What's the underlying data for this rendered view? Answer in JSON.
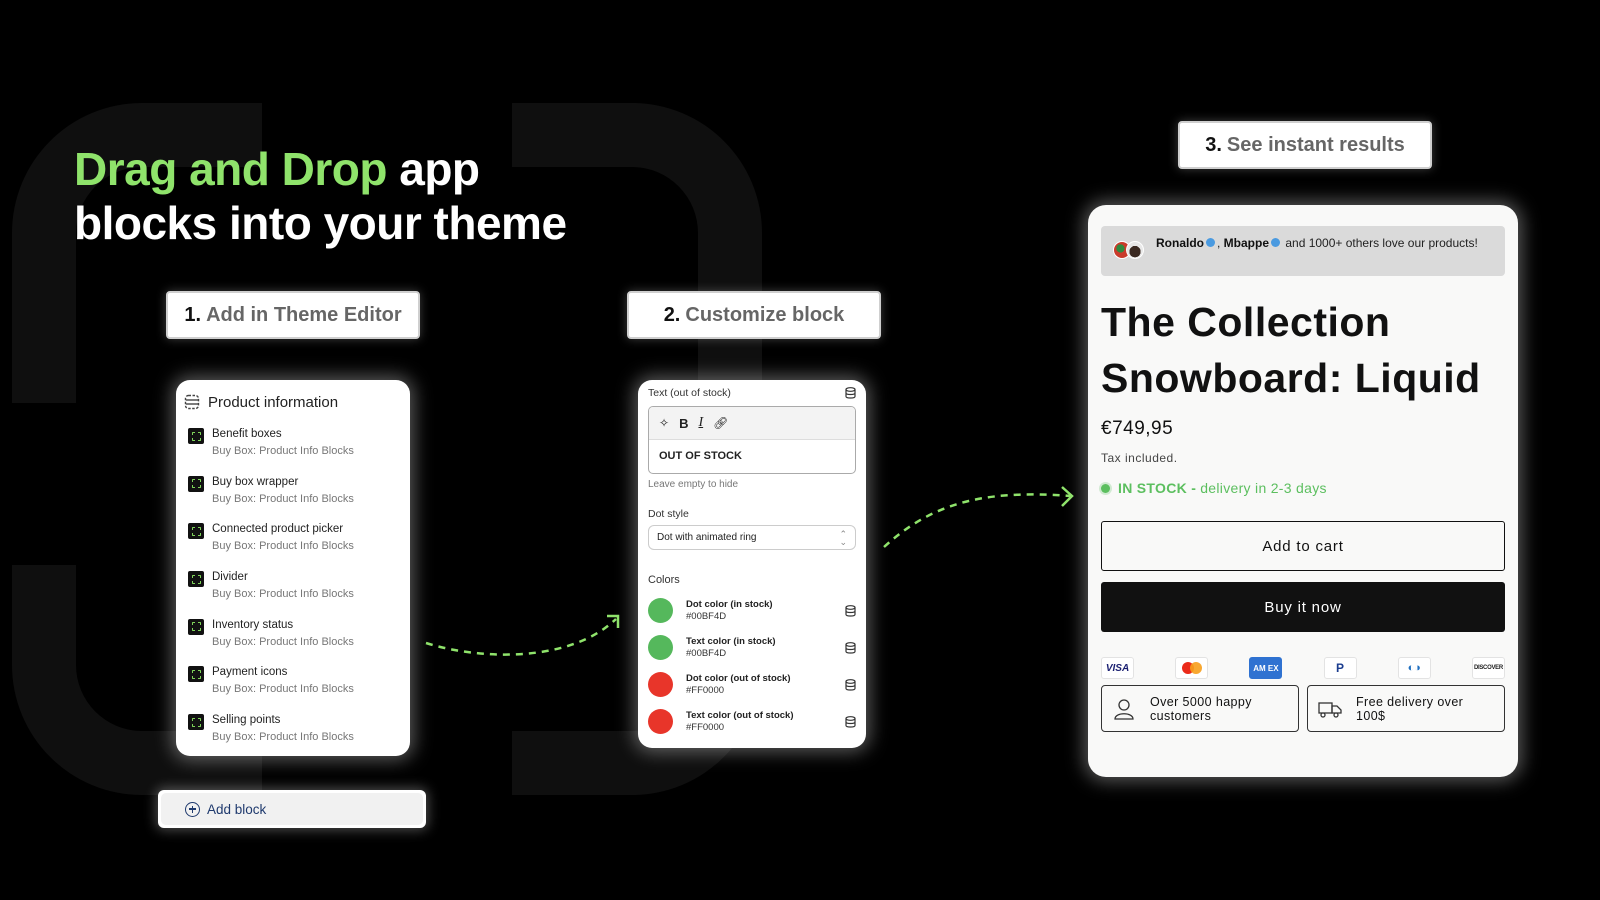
{
  "headline": {
    "accent": "Drag and Drop",
    "rest_line1": " app",
    "line2": "blocks into your theme",
    "accent_color": "#8fe36b"
  },
  "steps": [
    {
      "num": "1.",
      "label": "Add in Theme Editor"
    },
    {
      "num": "2.",
      "label": "Customize block"
    },
    {
      "num": "3.",
      "label": "See instant results"
    }
  ],
  "theme_editor": {
    "section_icon": "section-icon",
    "section_title": "Product information",
    "items": [
      {
        "name": "Benefit boxes",
        "source": "Buy Box: Product Info Blocks"
      },
      {
        "name": "Buy box wrapper",
        "source": "Buy Box: Product Info Blocks"
      },
      {
        "name": "Connected product picker",
        "source": "Buy Box: Product Info Blocks"
      },
      {
        "name": "Divider",
        "source": "Buy Box: Product Info Blocks"
      },
      {
        "name": "Inventory status",
        "source": "Buy Box: Product Info Blocks"
      },
      {
        "name": "Payment icons",
        "source": "Buy Box: Product Info Blocks"
      },
      {
        "name": "Selling points",
        "source": "Buy Box: Product Info Blocks"
      }
    ],
    "add_block_label": "Add block"
  },
  "customize": {
    "text_label": "Text (out of stock)",
    "text_value": "OUT OF STOCK",
    "toolbar": {
      "bold": "B",
      "italic": "I"
    },
    "help_text": "Leave empty to hide",
    "dot_style_label": "Dot style",
    "dot_style_value": "Dot with animated ring",
    "colors_title": "Colors",
    "colors": [
      {
        "label": "Dot color (in stock)",
        "value": "#00BF4D",
        "swatch": "#55b85c"
      },
      {
        "label": "Text color (in stock)",
        "value": "#00BF4D",
        "swatch": "#55b85c"
      },
      {
        "label": "Dot color (out of stock)",
        "value": "#FF0000",
        "swatch": "#e8352a"
      },
      {
        "label": "Text color (out of stock)",
        "value": "#FF0000",
        "swatch": "#e8352a"
      }
    ]
  },
  "product": {
    "social": {
      "name1": "Ronaldo",
      "sep": ", ",
      "name2": "Mbappe",
      "rest": " and 1000+ others love our products!"
    },
    "title": "The Collection Snowboard: Liquid",
    "price": "€749,95",
    "tax": "Tax included.",
    "stock_status": "IN STOCK -",
    "stock_detail": "delivery in 2-3 days",
    "stock_color": "#5cbf5f",
    "add_to_cart": "Add to cart",
    "buy_now": "Buy it now",
    "payments": [
      {
        "name": "visa",
        "label": "VISA"
      },
      {
        "name": "mastercard",
        "label": ""
      },
      {
        "name": "amex",
        "label": "AM EX"
      },
      {
        "name": "paypal",
        "label": "P"
      },
      {
        "name": "diners",
        "label": "◐◑"
      },
      {
        "name": "discover",
        "label": "DISCOVER"
      }
    ],
    "benefits": [
      {
        "icon": "customers-icon",
        "text": "Over 5000 happy customers"
      },
      {
        "icon": "truck-icon",
        "text": "Free delivery over 100$"
      }
    ]
  }
}
